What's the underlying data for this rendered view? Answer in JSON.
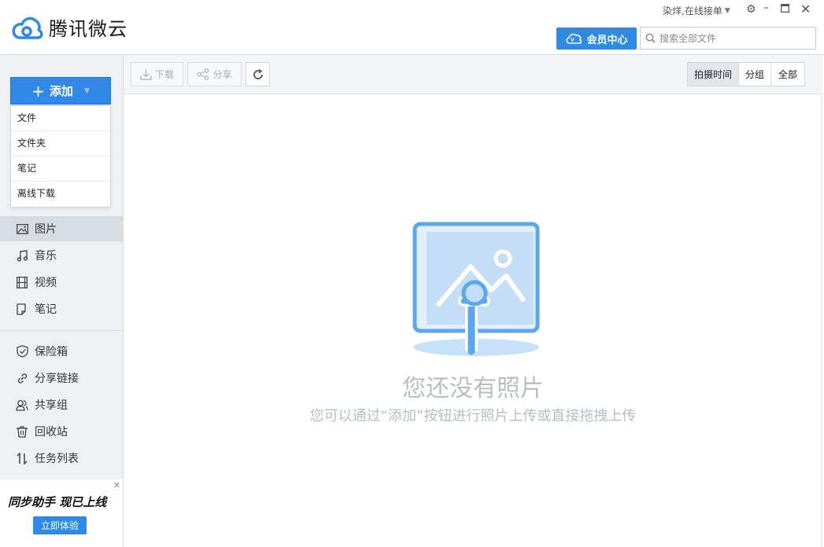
{
  "app": {
    "title": "腾讯微云"
  },
  "header": {
    "account": "染烊,在线接单",
    "vip_label": "会员中心",
    "search_placeholder": "搜索全部文件"
  },
  "sidebar": {
    "add_label": "添加",
    "add_menu": [
      "文件",
      "文件夹",
      "笔记",
      "离线下载"
    ],
    "nav": [
      {
        "label": "图片",
        "icon": "image-icon",
        "active": true
      },
      {
        "label": "音乐",
        "icon": "music-icon",
        "active": false
      },
      {
        "label": "视频",
        "icon": "video-icon",
        "active": false
      },
      {
        "label": "笔记",
        "icon": "note-icon",
        "active": false
      }
    ],
    "tools": [
      {
        "label": "保险箱",
        "icon": "shield-icon"
      },
      {
        "label": "分享链接",
        "icon": "link-icon"
      },
      {
        "label": "共享组",
        "icon": "group-icon"
      },
      {
        "label": "回收站",
        "icon": "trash-icon"
      },
      {
        "label": "任务列表",
        "icon": "transfer-icon"
      }
    ],
    "promo": {
      "title": "同步助手 现已上线",
      "button": "立即体验"
    }
  },
  "toolbar": {
    "download_label": "下载",
    "share_label": "分享",
    "view_modes": [
      {
        "label": "拍摄时间",
        "active": true
      },
      {
        "label": "分组",
        "active": false
      },
      {
        "label": "全部",
        "active": false
      }
    ]
  },
  "empty_state": {
    "title": "您还没有照片",
    "subtitle": "您可以通过“添加”按钮进行照片上传或直接拖拽上传"
  },
  "colors": {
    "accent": "#2e8ae6",
    "illustration": "#5aa7ee"
  }
}
